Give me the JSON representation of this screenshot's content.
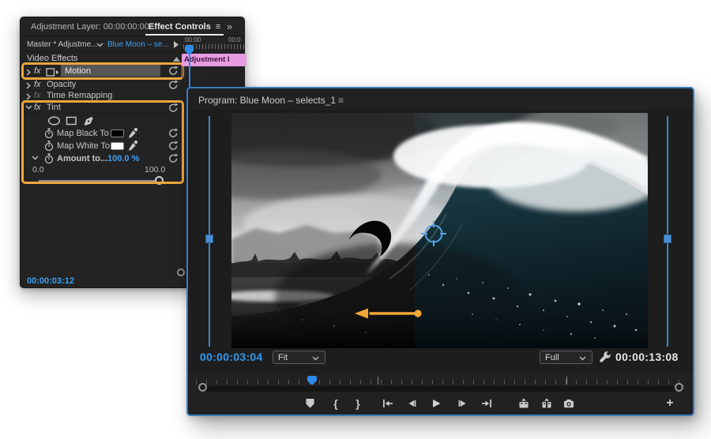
{
  "icons": {
    "panel_menu": "≡",
    "overflow": "»",
    "mark_in": "{",
    "mark_out": "}",
    "plus": "+"
  },
  "effect_controls": {
    "header_title": "Adjustment Layer: 00:00:00:00",
    "tab": "Effect Controls",
    "source_master": "Master * Adjustme...",
    "source_sequence": "Blue Moon – se...",
    "ruler_label_1": ":00:00",
    "ruler_label_2": "00:0",
    "clip_bar": "Adjustment l",
    "section": "Video Effects",
    "fx_badge": "fx",
    "motion": "Motion",
    "opacity": "Opacity",
    "time_remapping": "Time Remapping",
    "tint": "Tint",
    "map_black": "Map Black To",
    "map_white": "Map White To",
    "amount": "Amount to...",
    "amount_value": "100.0 %",
    "slider_min": "0.0",
    "slider_max": "100.0",
    "timecode": "00:00:03:12"
  },
  "program": {
    "title": "Program: Blue Moon – selects_1",
    "current_timecode": "00:00:03:04",
    "zoom_level": "Fit",
    "resolution": "Full",
    "duration": "00:00:13:08"
  },
  "colors": {
    "accent_blue": "#2d8ceb",
    "highlight_orange": "#eea63e",
    "clip_pink": "#e79ce2",
    "panel_border_blue": "#3b7cc0"
  }
}
